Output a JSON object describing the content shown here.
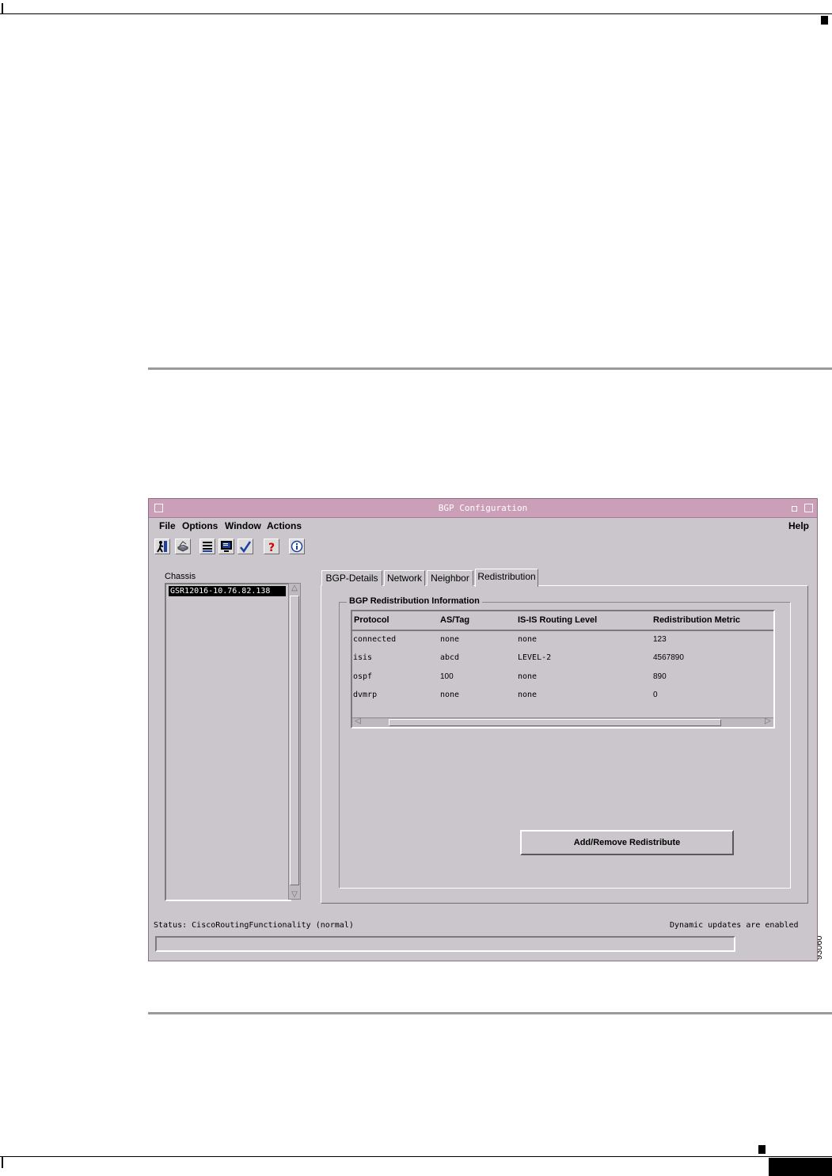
{
  "figure_id": "93060",
  "window": {
    "title": "BGP Configuration",
    "menus": [
      {
        "label": "File"
      },
      {
        "label": "Options"
      },
      {
        "label": "Window"
      },
      {
        "label": "Actions"
      }
    ],
    "help_menu": "Help",
    "toolbar_icons": [
      "exit-icon",
      "print-icon",
      "list-icon",
      "monitor-icon",
      "check-icon",
      "help-icon",
      "info-icon"
    ],
    "chassis": {
      "label": "Chassis",
      "selected": "GSR12016-10.76.82.138"
    },
    "tabs": [
      {
        "label": "BGP-Details",
        "active": false
      },
      {
        "label": "Network",
        "active": false
      },
      {
        "label": "Neighbor",
        "active": false
      },
      {
        "label": "Redistribution",
        "active": true
      }
    ],
    "group_title": "BGP Redistribution Information",
    "table": {
      "columns": [
        "Protocol",
        "AS/Tag",
        "IS-IS Routing Level",
        "Redistribution Metric"
      ],
      "rows": [
        [
          "connected",
          "none",
          "none",
          "123"
        ],
        [
          "isis",
          "abcd",
          "LEVEL-2",
          "4567890"
        ],
        [
          "ospf",
          "100",
          "none",
          "890"
        ],
        [
          "dvmrp",
          "none",
          "none",
          "0"
        ]
      ]
    },
    "add_remove_button": "Add/Remove Redistribute",
    "status_text": "Status: CiscoRoutingFunctionality (normal)",
    "updates_text": "Dynamic updates are enabled"
  },
  "colors": {
    "window_bg": "#cac6cb",
    "title_bar": "#cb9fb7"
  }
}
